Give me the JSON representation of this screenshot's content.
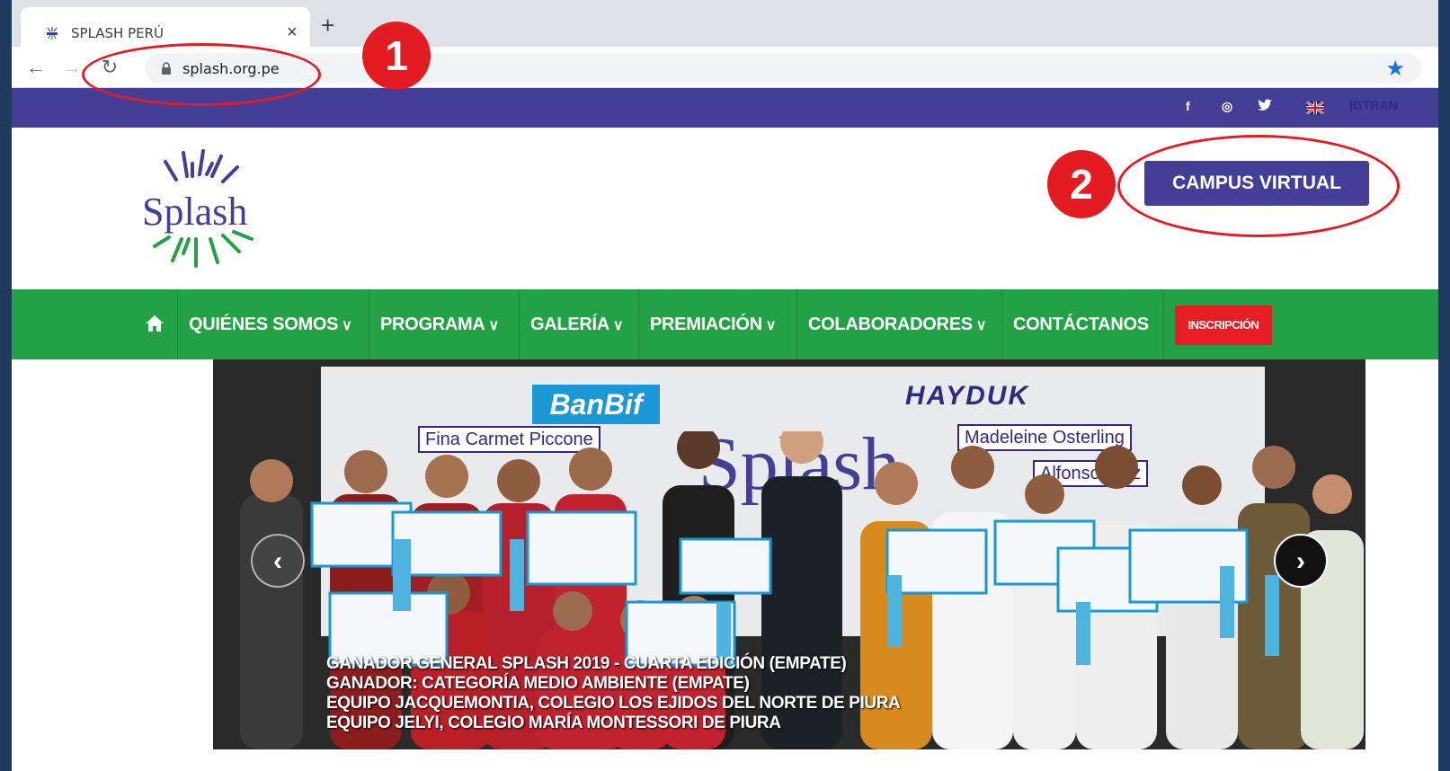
{
  "browser": {
    "tab_title": "SPLASH PERÚ",
    "tab_close": "×",
    "new_tab": "+",
    "url": "splash.org.pe"
  },
  "topbar": {
    "social": [
      "f",
      "◎",
      "🐦"
    ],
    "gtranslate": "|GTRAN"
  },
  "header": {
    "logo_text": "Splash",
    "campus_button": "CAMPUS VIRTUAL"
  },
  "nav": {
    "items": [
      {
        "label": "QUIÉNES SOMOS",
        "dropdown": true
      },
      {
        "label": "PROGRAMA",
        "dropdown": true
      },
      {
        "label": "GALERÍA",
        "dropdown": true
      },
      {
        "label": "PREMIACIÓN",
        "dropdown": true
      },
      {
        "label": "COLABORADORES",
        "dropdown": true
      },
      {
        "label": "CONTÁCTANOS",
        "dropdown": false
      }
    ],
    "inscripcion": "INSCRIPCIÓN",
    "chevron": "∨"
  },
  "slider": {
    "banner": {
      "banbif": "BanBif",
      "fina": "Fina Carmet Piccone",
      "hayduk": "HAYDUK",
      "madeleine": "Madeleine Osterling",
      "alfonso": "Alfonso Araz",
      "splash": "Splash"
    },
    "caption_lines": [
      "GANADOR GENERAL SPLASH 2019 - CUARTA EDICIÓN (EMPATE)",
      "GANADOR: CATEGORÍA MEDIO AMBIENTE (EMPATE)",
      "EQUIPO JACQUEMONTIA, COLEGIO LOS EJIDOS DEL NORTE DE PIURA",
      "EQUIPO JELYI, COLEGIO MARÍA MONTESSORI DE PIURA"
    ],
    "prev": "‹",
    "next": "›"
  },
  "annotations": {
    "badge_1": "1",
    "badge_2": "2",
    "color": "#e31b23"
  },
  "colors": {
    "purple": "#433f96",
    "green": "#22a245",
    "red": "#e51e25"
  }
}
